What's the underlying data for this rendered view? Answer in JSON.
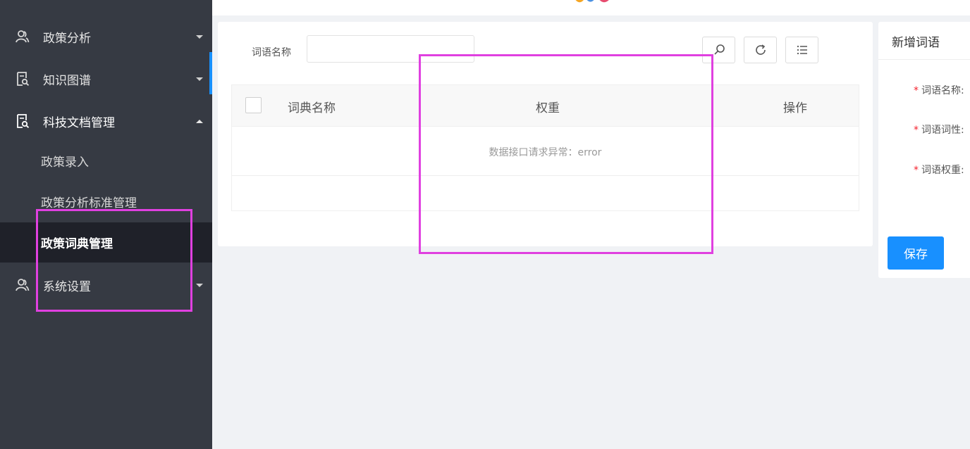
{
  "sidebar": {
    "menu": [
      {
        "label": "政策分析",
        "icon": "user-group-icon",
        "expanded": false
      },
      {
        "label": "知识图谱",
        "icon": "document-search-icon",
        "expanded": false
      },
      {
        "label": "科技文档管理",
        "icon": "document-search-icon",
        "expanded": true
      },
      {
        "label": "系统设置",
        "icon": "user-group-icon",
        "expanded": false
      }
    ],
    "submenu": [
      {
        "label": "政策录入"
      },
      {
        "label": "政策分析标准管理"
      },
      {
        "label": "政策词典管理",
        "active": true
      }
    ]
  },
  "search": {
    "label": "词语名称",
    "value": "",
    "buttons": [
      "search-icon",
      "refresh-icon",
      "list-icon"
    ]
  },
  "table": {
    "columns": [
      "词典名称",
      "权重",
      "操作"
    ],
    "empty_text": "数据接口请求异常：error"
  },
  "panel": {
    "title": "新增词语",
    "fields": [
      {
        "label": "词语名称:",
        "required": true
      },
      {
        "label": "词语词性:",
        "required": true
      },
      {
        "label": "词语权重:",
        "required": true
      }
    ],
    "save_label": "保存"
  },
  "colors": {
    "sidebar_bg": "#363a43",
    "sidebar_active_bg": "#1f2129",
    "primary": "#1890ff",
    "highlight": "#e040e0",
    "required": "#f5222d"
  }
}
